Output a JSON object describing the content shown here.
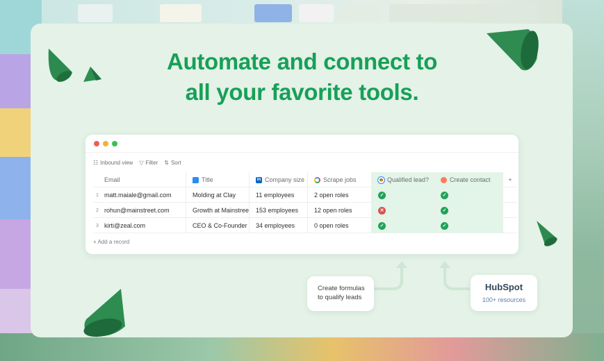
{
  "headline": {
    "line1": "Automate and connect to",
    "line2": "all your favorite tools."
  },
  "colors": {
    "accent_green": "#17a058",
    "card_bg": "#e4f2e7",
    "check_green": "#20a35a",
    "cross_red": "#d9534f",
    "dot_red": "#ee5b5b",
    "dot_yellow": "#f2b233",
    "dot_green": "#3bbf55"
  },
  "toolbar": {
    "view_label": "Inbound view",
    "filter_label": "Filter",
    "sort_label": "Sort"
  },
  "table": {
    "columns": [
      {
        "label": "Email",
        "icon": "none"
      },
      {
        "label": "Title",
        "icon": "title-field-icon"
      },
      {
        "label": "Company size",
        "icon": "linkedin-icon"
      },
      {
        "label": "Scrape jobs",
        "icon": "google-icon"
      },
      {
        "label": "Qualified lead?",
        "icon": "chrome-icon"
      },
      {
        "label": "Create contact",
        "icon": "hubspot-icon"
      }
    ],
    "add_column_label": "+",
    "rows": [
      {
        "num": "1",
        "email": "matt.maiale@gmail.com",
        "title": "Molding at Clay",
        "company_size": "11 employees",
        "scrape_jobs": "2 open roles",
        "qualified": "check",
        "contact": "check"
      },
      {
        "num": "2",
        "email": "rohun@mainstreet.com",
        "title": "Growth at Mainstree",
        "company_size": "153 employees",
        "scrape_jobs": "12 open roles",
        "qualified": "cross",
        "contact": "check"
      },
      {
        "num": "3",
        "email": "kirti@zeal.com",
        "title": "CEO & Co-Founder",
        "company_size": "34 employees",
        "scrape_jobs": "0 open roles",
        "qualified": "check",
        "contact": "check"
      }
    ],
    "add_record_label": "+ Add a record"
  },
  "callouts": {
    "formula_line1": "Create formulas",
    "formula_line2": "to qualify leads",
    "hubspot_logo": "HubSpot",
    "hubspot_sub": "100+ resources"
  }
}
